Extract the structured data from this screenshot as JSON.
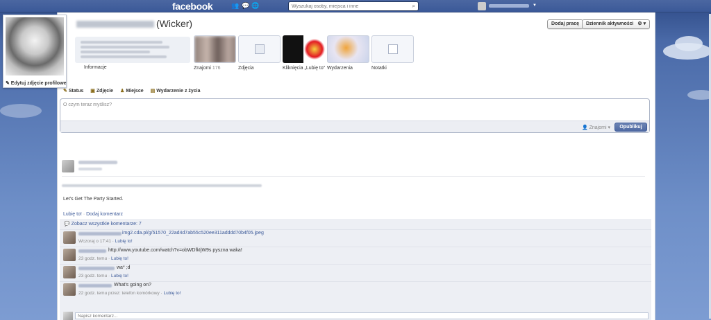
{
  "topbar": {
    "logo": "facebook",
    "search_placeholder": "Wyszukaj osoby, miejsca i inne",
    "icons": [
      "friend-requests-icon",
      "messages-icon",
      "notifications-icon"
    ]
  },
  "profile": {
    "name_suffix": "(Wicker)",
    "edit_photo": "✎ Edytuj zdjęcie profilowe",
    "add_job": "Dodaj pracę",
    "activity_log": "Dziennik aktywności",
    "activity_log_gear": "⚙ ▾"
  },
  "tiles": {
    "info": "Informacje",
    "friends": "Znajomi",
    "friends_count": "176",
    "photos": "Zdjęcia",
    "likes": "Kliknięcia „Lubię to\"",
    "events": "Wydarzenia",
    "notes": "Notatki"
  },
  "composer": {
    "tab_status": "Status",
    "tab_photo": "Zdjęcie",
    "tab_place": "Miejsce",
    "tab_life_event": "Wydarzenie z życia",
    "placeholder": "O czym teraz myślisz?",
    "audience": "Znajomi",
    "publish": "Opublikuj"
  },
  "post": {
    "text": "Let's Get The Party Started.",
    "like": "Lubię to!",
    "sep": "·",
    "comment": "Dodaj komentarz"
  },
  "comments": {
    "view_all": "Zobacz wszystkie komentarze: 7",
    "items": [
      {
        "text": "img2.cda.pl/g/51570_22ad4d7ab55c520ee311adddd70b4f05.jpeg",
        "meta": "Wczoraj o 17:41",
        "like": "Lubię to!"
      },
      {
        "text": "http://www.youtube.com/watch?v=obWDfkIjW9s pyszna waka!",
        "meta": "23 godz. temu",
        "like": "Lubię to!"
      },
      {
        "text": "wa* ;d",
        "meta": "23 godz. temu",
        "like": "Lubię to!"
      },
      {
        "text": "What's going on?",
        "meta": "22 godz. temu przez: telefon komórkowy",
        "like": "Lubię to!"
      }
    ],
    "write_placeholder": "Napisz komentarz..."
  }
}
